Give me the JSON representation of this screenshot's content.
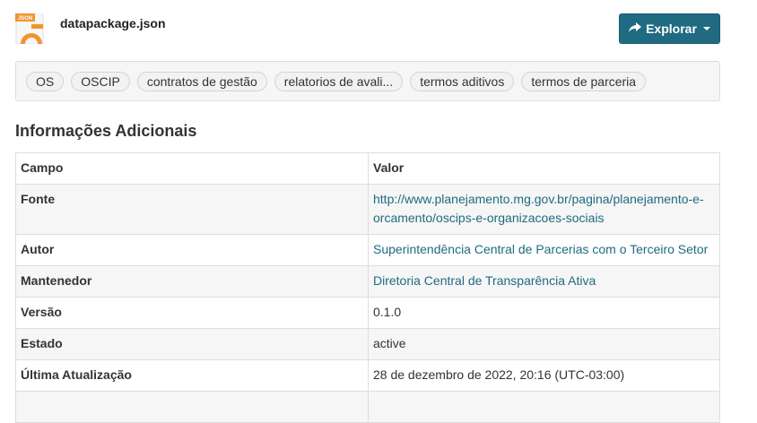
{
  "header": {
    "file_icon_label": "JSON",
    "file_name": "datapackage.json",
    "explore_label": "Explorar"
  },
  "tags": [
    "OS",
    "OSCIP",
    "contratos de gestão",
    "relatorios de avali...",
    "termos aditivos",
    "termos de parceria"
  ],
  "section_title": "Informações Adicionais",
  "table": {
    "headers": [
      "Campo",
      "Valor"
    ],
    "rows": [
      {
        "field": "Fonte",
        "value": "http://www.planejamento.mg.gov.br/pagina/planejamento-e-orcamento/oscips-e-organizacoes-sociais"
      },
      {
        "field": "Autor",
        "value": "Superintendência Central de Parcerias com o Terceiro Setor"
      },
      {
        "field": "Mantenedor",
        "value": "Diretoria Central de Transparência Ativa"
      },
      {
        "field": "Versão",
        "value": "0.1.0"
      },
      {
        "field": "Estado",
        "value": "active"
      },
      {
        "field": "Última Atualização",
        "value": "28 de dezembro de 2022, 20:16 (UTC-03:00)"
      }
    ]
  },
  "colors": {
    "accent": "#206b82",
    "icon_orange": "#f0952e"
  }
}
